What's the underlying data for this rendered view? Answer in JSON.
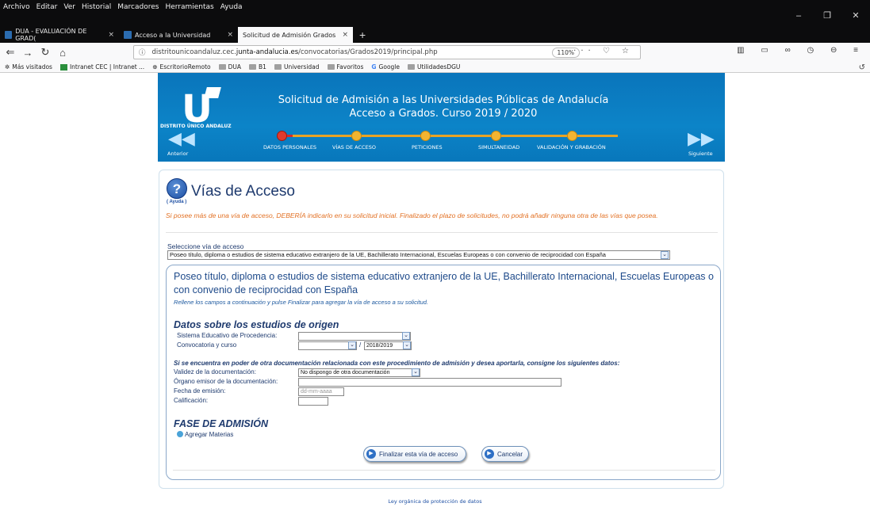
{
  "browser": {
    "menu": [
      "Archivo",
      "Editar",
      "Ver",
      "Historial",
      "Marcadores",
      "Herramientas",
      "Ayuda"
    ],
    "tabs": [
      {
        "label": "DUA - EVALUACIÓN DE GRAD(",
        "close": "×"
      },
      {
        "label": "Acceso a la Universidad",
        "close": "×"
      },
      {
        "label": "Solicitud de Admisión Grados",
        "close": "×"
      }
    ],
    "new_tab": "+",
    "url_prefix": "distritounicoandaluz.cec.",
    "url_domain": "junta-andalucia.es",
    "url_path": "/convocatorias/Grados2019/principal.php",
    "zoom": "110%",
    "bookmarks": [
      "Más visitados",
      "Intranet CEC | Intranet ...",
      "EscritorioRemoto",
      "DUA",
      "B1",
      "Universidad",
      "Favoritos",
      "Google",
      "UtilidadesDGU"
    ]
  },
  "banner": {
    "logo_text": "DISTRITO ÚNICO ANDALUZ",
    "title_line1": "Solicitud de Admisión a las Universidades Públicas de Andalucía",
    "title_line2": "Acceso a Grados. Curso 2019 / 2020",
    "steps": [
      "DATOS PERSONALES",
      "VÍAS DE ACCESO",
      "PETICIONES",
      "SIMULTANEIDAD",
      "VALIDACIÓN Y GRABACIÓN"
    ],
    "prev": "Anterior",
    "next": "Siguiente"
  },
  "form": {
    "help_label": "( Ayuda )",
    "title": "Vías de Acceso",
    "warning": "Si posee más de una vía de acceso, DEBERÍA indicarlo en su solicitud inicial. Finalizado el plazo de solicitudes, no podrá añadir ninguna otra de las vías que posea.",
    "select_label": "Seleccione vía de acceso",
    "selected_via": "Poseo título, diploma o estudios de sistema educativo extranjero de la UE, Bachillerato Internacional, Escuelas Europeas o con convenio de reciprocidad con España",
    "via_title": "Poseo título, diploma o estudios de sistema educativo extranjero de la UE, Bachillerato Internacional, Escuelas Europeas o con convenio de reciprocidad con España",
    "via_sub": "Rellene los campos a continuación y pulse Finalizar para agregar la vía de acceso a su solicitud.",
    "origen_heading": "Datos sobre los estudios de origen",
    "sistema_label": "Sistema Educativo de Procedencia:",
    "convocatoria_label": "Convocatoria y curso",
    "curso_value": "2018/2019",
    "slash": "/",
    "otra_heading": "Si se encuentra en poder de otra documentación relacionada con este procedimiento de admisión y desea aportarla, consigne los siguientes datos:",
    "validez_label": "Validez de la documentación:",
    "validez_value": "No dispongo de otra documentación",
    "organo_label": "Órgano emisor de la documentación:",
    "fecha_label": "Fecha de emisión:",
    "fecha_placeholder": "dd-mm-aaaa",
    "calificacion_label": "Calificación:",
    "fase_heading": "FASE DE ADMISIÓN",
    "agregar": "Agregar Materias",
    "finalizar": "Finalizar esta vía de acceso",
    "cancelar": "Cancelar"
  },
  "footer": "Ley orgánica de protección de datos"
}
